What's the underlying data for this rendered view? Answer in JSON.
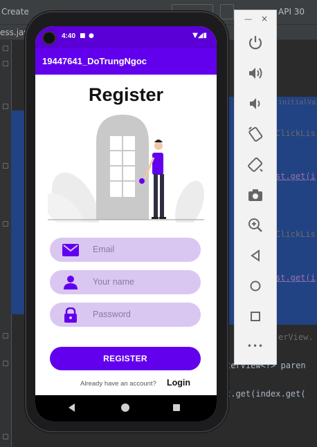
{
  "ide": {
    "create_label": "Create",
    "api_label": "API 30",
    "tab_label": "ess.java",
    "code_lines": {
      "line1": "initialValu",
      "line2": "ClickLis",
      "line3": "st.get(i",
      "line4": "ClickLis",
      "line5": "st.get(i",
      "line6": "erView.",
      "line7": "terView<?> paren",
      "line8": "t.get(index.get("
    }
  },
  "phone": {
    "status_time": "4:40",
    "app_title": "19447641_DoTrungNgoc",
    "heading": "Register",
    "fields": {
      "email_placeholder": "Email",
      "name_placeholder": "Your name",
      "password_placeholder": "Password"
    },
    "register_button": "REGISTER",
    "already_text": "Already have an account?",
    "login_link": "Login"
  },
  "emulator": {
    "minimize_label": "—",
    "close_label": "×",
    "more_label": "•••"
  },
  "colors": {
    "primary": "#6200ee",
    "status_bar": "#5a00d6",
    "field_bg": "#d9c7f2",
    "selection": "#214283"
  },
  "icons": [
    "power-icon",
    "volume-up-icon",
    "volume-down-icon",
    "rotate-left-icon",
    "rotate-right-icon",
    "camera-icon",
    "zoom-icon",
    "back-icon",
    "home-icon",
    "overview-icon",
    "more-icon"
  ]
}
